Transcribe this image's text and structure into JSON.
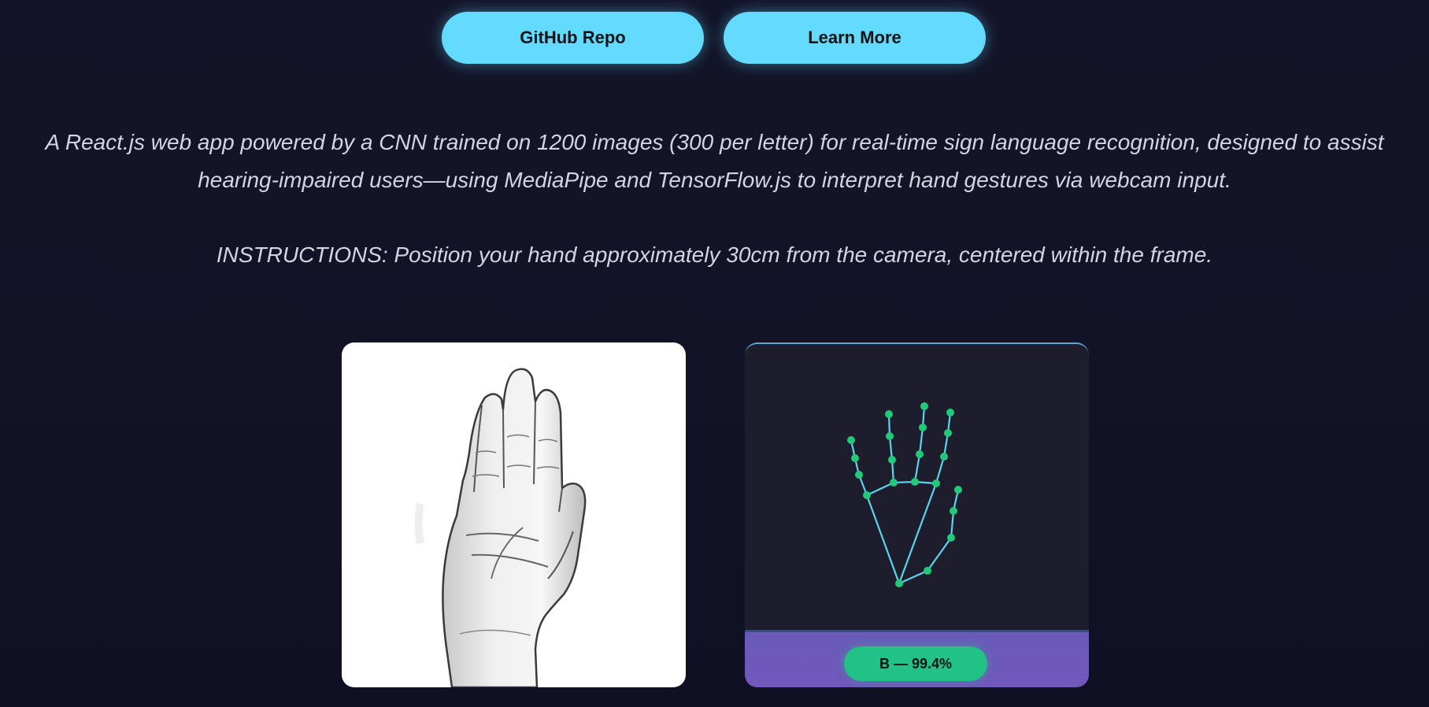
{
  "buttons": {
    "github_label": "GitHub Repo",
    "learn_more_label": "Learn More"
  },
  "description": "A React.js web app powered by a CNN trained on 1200 images (300 per letter) for real-time sign language recognition, designed to assist hearing-impaired users—using MediaPipe and TensorFlow.js to interpret hand gestures via webcam input.",
  "instructions": "INSTRUCTIONS: Position your hand approximately 30cm from the camera, centered within the frame.",
  "prediction": {
    "label": "B — 99.4%"
  },
  "colors": {
    "background": "#12132a",
    "button": "#61dafb",
    "landmark": "#22c97a",
    "connection": "#5ad4f0",
    "badge": "#22c185",
    "prediction_bar": "#6a5bb9"
  },
  "icons": {
    "reference": "open-hand-sign-b-illustration",
    "tracking": "hand-landmarks-skeleton"
  }
}
